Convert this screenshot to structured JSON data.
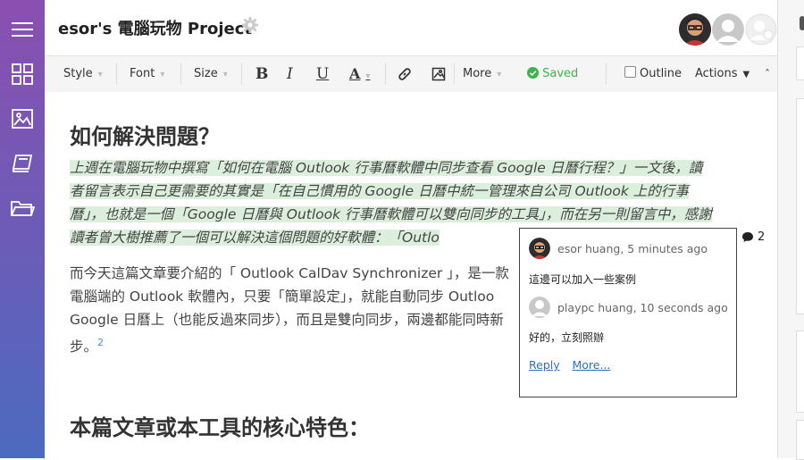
{
  "header": {
    "title": "esor's 電腦玩物 Project"
  },
  "toolbar": {
    "style": "Style",
    "font": "Font",
    "size": "Size",
    "bold": "B",
    "italic": "I",
    "underline": "U",
    "color": "A",
    "more": "More",
    "saved": "Saved",
    "outline": "Outline",
    "actions": "Actions",
    "collapse": "ˆ"
  },
  "doc": {
    "heading1": "如何解決問題？",
    "highlight": "上週在電腦玩物中撰寫「如何在電腦 Outlook 行事曆軟體中同步查看 Google 日曆行程？」一文後，讀者留言表示自己更需要的其實是「在自己慣用的 Google 日曆中統一管理來自公司 Outlook 上的行事曆」，也就是一個「Google 日曆與 Outlook 行事曆軟體可以雙向同步的工具」，而在另一則留言中，感謝讀者曾大樹推薦了一個可以解決這個問題的好軟體：「Outlo",
    "para": "而今天這篇文章要介紹的「 Outlook CalDav Synchronizer 」，是一款",
    "para_line2": "電腦端的 Outlook 軟體內，只要「簡單設定」，就能自動同步 Outloo",
    "para_line3": "Google 日曆上（也能反過來同步），而且是雙向同步，兩邊都能同時新",
    "para_line4": "步。",
    "footnote": "2",
    "heading2": "本篇文章或本工具的核心特色："
  },
  "comments": {
    "count": "2",
    "items": [
      {
        "author_meta": "esor huang, 5 minutes ago",
        "text": "這邊可以加入一些案例"
      },
      {
        "author_meta": "playpc huang, 10 seconds ago",
        "text": "好的，立刻照辦"
      }
    ],
    "reply": "Reply",
    "more": "More..."
  },
  "colors": {
    "highlight": "#dcefdc",
    "saved": "#3bb54a",
    "link": "#2f6fbf"
  }
}
